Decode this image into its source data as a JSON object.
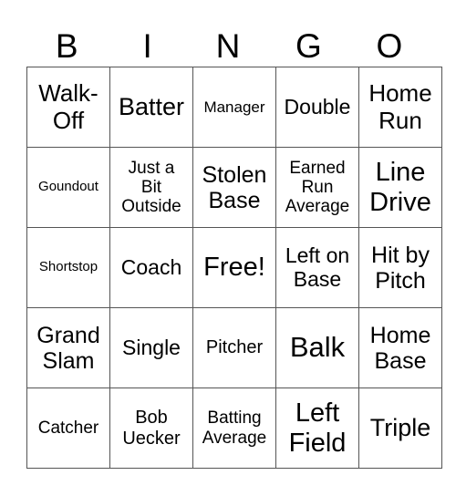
{
  "header": [
    "B",
    "I",
    "N",
    "G",
    "O"
  ],
  "cells": [
    [
      "Walk-\nOff",
      "Batter",
      "Manager",
      "Double",
      "Home\nRun"
    ],
    [
      "Goundout",
      "Just a\nBit\nOutside",
      "Stolen\nBase",
      "Earned\nRun\nAverage",
      "Line\nDrive"
    ],
    [
      "Shortstop",
      "Coach",
      "Free!",
      "Left on\nBase",
      "Hit by\nPitch"
    ],
    [
      "Grand\nSlam",
      "Single",
      "Pitcher",
      "Balk",
      "Home\nBase"
    ],
    [
      "Catcher",
      "Bob\nUecker",
      "Batting\nAverage",
      "Left\nField",
      "Triple"
    ]
  ]
}
